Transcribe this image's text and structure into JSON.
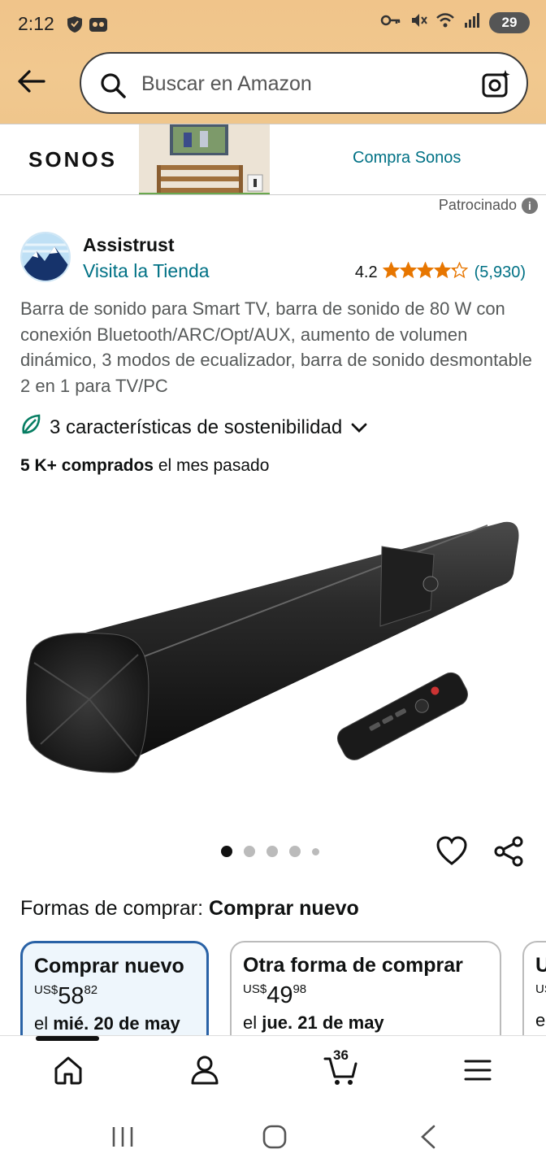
{
  "status_bar": {
    "time": "2:12",
    "battery": "29"
  },
  "search": {
    "placeholder": "Buscar en Amazon"
  },
  "banner": {
    "brand": "SONOS",
    "link": "Compra Sonos",
    "sponsored": "Patrocinado"
  },
  "seller": {
    "name": "Assistrust",
    "store_link": "Visita la Tienda",
    "rating_value": "4.2",
    "rating_count": "(5,930)",
    "stars": 4.2
  },
  "product": {
    "title": "Barra de sonido para Smart TV, barra de sonido de 80 W con conexión Bluetooth/ARC/Opt/AUX, aumento de volumen dinámico, 3 modos de ecualizador, barra de sonido desmontable 2 en 1 para TV/PC",
    "sustainability": "3 características de sostenibilidad",
    "bought_bold": "5 K+ comprados",
    "bought_rest": " el mes pasado",
    "image_count": 5,
    "image_index": 1
  },
  "ways_to_buy": {
    "label": "Formas de comprar: ",
    "selected": "Comprar nuevo",
    "cards": [
      {
        "title": "Comprar nuevo",
        "currency": "US$",
        "price_whole": "58",
        "price_cents": "82",
        "delivery_prefix": "el ",
        "delivery_date": "mié. 20 de may"
      },
      {
        "title": "Otra forma de comprar",
        "currency": "US$",
        "price_whole": "49",
        "price_cents": "98",
        "delivery_prefix": "el ",
        "delivery_date": "jue. 21 de may"
      },
      {
        "title": "U",
        "currency": "US",
        "price_whole": "",
        "price_cents": "",
        "delivery_prefix": "e",
        "delivery_date": ""
      }
    ]
  },
  "bottom_nav": {
    "cart_count": "36",
    "items": [
      "home-icon",
      "account-icon",
      "cart-icon",
      "menu-icon"
    ]
  },
  "colors": {
    "header": "#f0c48a",
    "link": "#007185",
    "star": "#e77600",
    "selected_border": "#2962a6"
  }
}
